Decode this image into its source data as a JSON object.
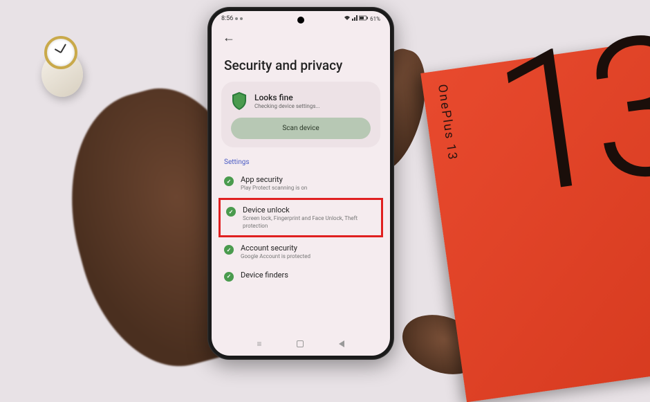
{
  "status_bar": {
    "time": "8:56",
    "battery": "61%"
  },
  "page": {
    "title": "Security and privacy"
  },
  "status_card": {
    "title": "Looks fine",
    "subtitle": "Checking device settings...",
    "button": "Scan device"
  },
  "section_label": "Settings",
  "items": [
    {
      "title": "App security",
      "subtitle": "Play Protect scanning is on"
    },
    {
      "title": "Device unlock",
      "subtitle": "Screen lock, Fingerprint and Face Unlock, Theft protection"
    },
    {
      "title": "Account security",
      "subtitle": "Google Account is protected"
    },
    {
      "title": "Device finders",
      "subtitle": ""
    }
  ],
  "box": {
    "brand": "OnePlus 13",
    "number": "13"
  }
}
